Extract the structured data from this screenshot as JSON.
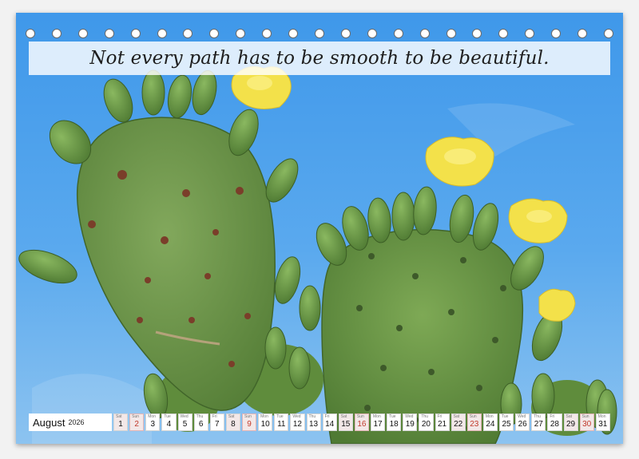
{
  "quote": "Not every path has to be smooth to be beautiful.",
  "calendar": {
    "month": "August",
    "year": "2026",
    "days": [
      {
        "wd": "Sat",
        "num": "1"
      },
      {
        "wd": "Sun",
        "num": "2"
      },
      {
        "wd": "Mon",
        "num": "3"
      },
      {
        "wd": "Tue",
        "num": "4"
      },
      {
        "wd": "Wed",
        "num": "5"
      },
      {
        "wd": "Thu",
        "num": "6"
      },
      {
        "wd": "Fri",
        "num": "7"
      },
      {
        "wd": "Sat",
        "num": "8"
      },
      {
        "wd": "Sun",
        "num": "9"
      },
      {
        "wd": "Mon",
        "num": "10"
      },
      {
        "wd": "Tue",
        "num": "11"
      },
      {
        "wd": "Wed",
        "num": "12"
      },
      {
        "wd": "Thu",
        "num": "13"
      },
      {
        "wd": "Fri",
        "num": "14"
      },
      {
        "wd": "Sat",
        "num": "15"
      },
      {
        "wd": "Sun",
        "num": "16"
      },
      {
        "wd": "Mon",
        "num": "17"
      },
      {
        "wd": "Tue",
        "num": "18"
      },
      {
        "wd": "Wed",
        "num": "19"
      },
      {
        "wd": "Thu",
        "num": "20"
      },
      {
        "wd": "Fri",
        "num": "21"
      },
      {
        "wd": "Sat",
        "num": "22"
      },
      {
        "wd": "Sun",
        "num": "23"
      },
      {
        "wd": "Mon",
        "num": "24"
      },
      {
        "wd": "Tue",
        "num": "25"
      },
      {
        "wd": "Wed",
        "num": "26"
      },
      {
        "wd": "Thu",
        "num": "27"
      },
      {
        "wd": "Fri",
        "num": "28"
      },
      {
        "wd": "Sat",
        "num": "29"
      },
      {
        "wd": "Sun",
        "num": "30"
      },
      {
        "wd": "Mon",
        "num": "31"
      }
    ]
  },
  "colors": {
    "sky": "#4aa0ea",
    "cactus": "#6e9a4a",
    "flower": "#f3e14a",
    "sunday": "#c0392b"
  }
}
